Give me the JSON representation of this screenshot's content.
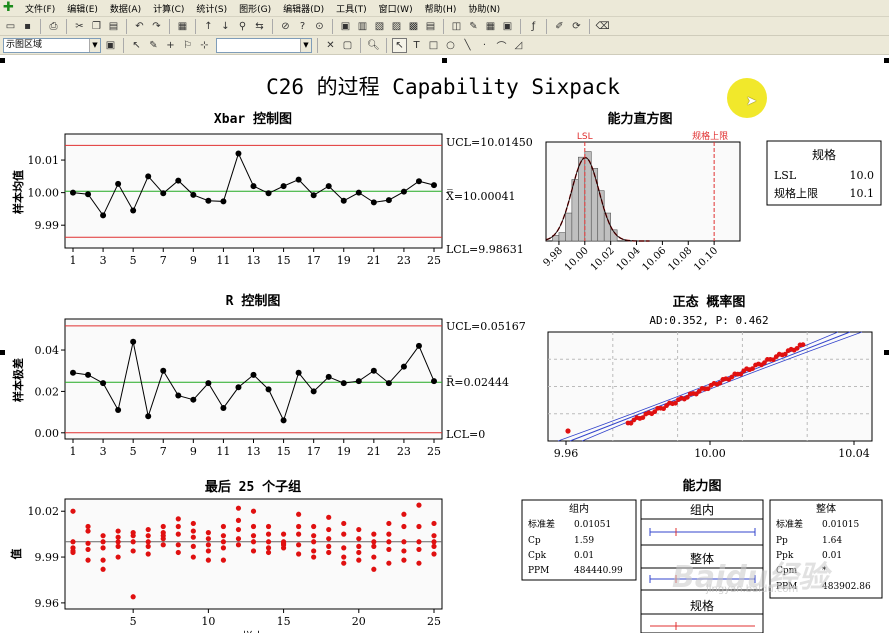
{
  "menu": [
    "文件(F)",
    "编辑(E)",
    "数据(A)",
    "计算(C)",
    "统计(S)",
    "图形(G)",
    "编辑器(D)",
    "工具(T)",
    "窗口(W)",
    "帮助(H)",
    "协助(N)"
  ],
  "toolbar": {
    "region_combo": "示图区域",
    "blank_combo": ""
  },
  "title": "C26 的过程 Capability Sixpack",
  "xbar": {
    "title": "Xbar 控制图",
    "ylabel": "样本均值",
    "ucl_label": "UCL=10.01450",
    "mean_label": "X̿=10.00041",
    "lcl_label": "LCL=9.98631",
    "ucl": 10.0145,
    "mean": 10.00041,
    "lcl": 9.98631,
    "yticks": [
      {
        "v": 9.99,
        "t": "9.99"
      },
      {
        "v": 10.0,
        "t": "10.00"
      },
      {
        "v": 10.01,
        "t": "10.01"
      }
    ],
    "ylim": [
      9.983,
      10.018
    ],
    "values": [
      10.0,
      9.9995,
      9.993,
      10.0027,
      9.9945,
      10.005,
      9.9998,
      10.0037,
      9.9993,
      9.9975,
      9.9973,
      10.012,
      10.002,
      9.9998,
      10.002,
      10.004,
      9.9992,
      10.002,
      9.9975,
      10.0,
      9.997,
      9.9977,
      10.0003,
      10.0035,
      10.0023
    ]
  },
  "rchart": {
    "title": "R 控制图",
    "ylabel": "样本极差",
    "ucl_label": "UCL=0.05167",
    "mean_label": "R̄=0.02444",
    "lcl_label": "LCL=0",
    "ucl": 0.05167,
    "mean": 0.02444,
    "lcl": 0,
    "yticks": [
      {
        "v": 0.0,
        "t": "0.00"
      },
      {
        "v": 0.02,
        "t": "0.02"
      },
      {
        "v": 0.04,
        "t": "0.04"
      }
    ],
    "ylim": [
      -0.003,
      0.055
    ],
    "values": [
      0.029,
      0.028,
      0.024,
      0.011,
      0.044,
      0.008,
      0.03,
      0.018,
      0.016,
      0.024,
      0.012,
      0.022,
      0.028,
      0.021,
      0.006,
      0.029,
      0.02,
      0.027,
      0.024,
      0.025,
      0.03,
      0.024,
      0.032,
      0.042,
      0.025
    ]
  },
  "xticks": [
    1,
    3,
    5,
    7,
    9,
    11,
    13,
    15,
    17,
    19,
    21,
    23,
    25
  ],
  "last25": {
    "title": "最后 25 个子组",
    "ylabel": "值",
    "xlabel": "样本",
    "center": 10.0,
    "ylim": [
      9.956,
      10.028
    ],
    "yticks": [
      {
        "v": 9.96,
        "t": "9.96"
      },
      {
        "v": 9.99,
        "t": "9.99"
      },
      {
        "v": 10.02,
        "t": "10.02"
      }
    ],
    "xticks": [
      5,
      10,
      15,
      20,
      25
    ],
    "points": [
      [
        1,
        10.02
      ],
      [
        1,
        10.0
      ],
      [
        1,
        9.996
      ],
      [
        1,
        9.994
      ],
      [
        1,
        9.993
      ],
      [
        2,
        10.01
      ],
      [
        2,
        10.007
      ],
      [
        2,
        9.999
      ],
      [
        2,
        9.995
      ],
      [
        2,
        9.988
      ],
      [
        3,
        10.004
      ],
      [
        3,
        10.0
      ],
      [
        3,
        9.996
      ],
      [
        3,
        9.988
      ],
      [
        3,
        9.982
      ],
      [
        4,
        10.007
      ],
      [
        4,
        10.003
      ],
      [
        4,
        10.0
      ],
      [
        4,
        9.997
      ],
      [
        4,
        9.99
      ],
      [
        5,
        10.006
      ],
      [
        5,
        10.004
      ],
      [
        5,
        10.0
      ],
      [
        5,
        9.994
      ],
      [
        5,
        9.964
      ],
      [
        6,
        10.008
      ],
      [
        6,
        10.004
      ],
      [
        6,
        10.0
      ],
      [
        6,
        9.997
      ],
      [
        6,
        9.992
      ],
      [
        7,
        10.01
      ],
      [
        7,
        10.006
      ],
      [
        7,
        10.004
      ],
      [
        7,
        10.002
      ],
      [
        7,
        9.998
      ],
      [
        8,
        10.015
      ],
      [
        8,
        10.01
      ],
      [
        8,
        10.005
      ],
      [
        8,
        9.998
      ],
      [
        8,
        9.993
      ],
      [
        9,
        10.012
      ],
      [
        9,
        10.007
      ],
      [
        9,
        10.003
      ],
      [
        9,
        9.997
      ],
      [
        9,
        9.99
      ],
      [
        10,
        10.006
      ],
      [
        10,
        10.002
      ],
      [
        10,
        9.998
      ],
      [
        10,
        9.994
      ],
      [
        10,
        9.988
      ],
      [
        11,
        10.01
      ],
      [
        11,
        10.004
      ],
      [
        11,
        10.0
      ],
      [
        11,
        9.996
      ],
      [
        11,
        9.988
      ],
      [
        12,
        10.022
      ],
      [
        12,
        10.014
      ],
      [
        12,
        10.008
      ],
      [
        12,
        10.002
      ],
      [
        12,
        9.998
      ],
      [
        13,
        10.02
      ],
      [
        13,
        10.01
      ],
      [
        13,
        10.004
      ],
      [
        13,
        10.0
      ],
      [
        13,
        9.994
      ],
      [
        14,
        10.01
      ],
      [
        14,
        10.005
      ],
      [
        14,
        10.0
      ],
      [
        14,
        9.996
      ],
      [
        14,
        9.993
      ],
      [
        15,
        10.005
      ],
      [
        15,
        10.0
      ],
      [
        15,
        9.998
      ],
      [
        15,
        9.996
      ],
      [
        15,
        9.999
      ],
      [
        16,
        10.018
      ],
      [
        16,
        10.01
      ],
      [
        16,
        10.005
      ],
      [
        16,
        9.998
      ],
      [
        16,
        9.992
      ],
      [
        17,
        10.01
      ],
      [
        17,
        10.004
      ],
      [
        17,
        10.0
      ],
      [
        17,
        9.994
      ],
      [
        17,
        9.99
      ],
      [
        18,
        10.016
      ],
      [
        18,
        10.008
      ],
      [
        18,
        10.002
      ],
      [
        18,
        9.997
      ],
      [
        18,
        9.993
      ],
      [
        19,
        10.012
      ],
      [
        19,
        10.005
      ],
      [
        19,
        9.996
      ],
      [
        19,
        9.99
      ],
      [
        19,
        9.986
      ],
      [
        20,
        10.008
      ],
      [
        20,
        10.002
      ],
      [
        20,
        9.997
      ],
      [
        20,
        9.993
      ],
      [
        20,
        9.988
      ],
      [
        21,
        10.005
      ],
      [
        21,
        10.0
      ],
      [
        21,
        9.997
      ],
      [
        21,
        9.99
      ],
      [
        21,
        9.982
      ],
      [
        22,
        10.012
      ],
      [
        22,
        10.005
      ],
      [
        22,
        10.0
      ],
      [
        22,
        9.995
      ],
      [
        22,
        9.986
      ],
      [
        23,
        10.018
      ],
      [
        23,
        10.01
      ],
      [
        23,
        10.0
      ],
      [
        23,
        9.994
      ],
      [
        23,
        9.988
      ],
      [
        24,
        10.024
      ],
      [
        24,
        10.01
      ],
      [
        24,
        10.0
      ],
      [
        24,
        9.995
      ],
      [
        24,
        9.986
      ],
      [
        25,
        10.012
      ],
      [
        25,
        10.004
      ],
      [
        25,
        10.0
      ],
      [
        25,
        9.997
      ],
      [
        25,
        9.992
      ]
    ]
  },
  "histogram": {
    "title": "能力直方图",
    "lsl_label": "LSL",
    "usl_label": "规格上限",
    "lsl": 10.0,
    "usl": 10.1,
    "xlim": [
      9.97,
      10.12
    ],
    "xticks": [
      9.98,
      10.0,
      10.02,
      10.04,
      10.06,
      10.08,
      10.1
    ],
    "xtick_labels": [
      "9.98",
      "10.00",
      "10.02",
      "10.04",
      "10.06",
      "10.08",
      "10.10"
    ],
    "bins": [
      {
        "x0": 9.975,
        "x1": 9.98,
        "h": 2
      },
      {
        "x0": 9.98,
        "x1": 9.985,
        "h": 3
      },
      {
        "x0": 9.985,
        "x1": 9.99,
        "h": 10
      },
      {
        "x0": 9.99,
        "x1": 9.995,
        "h": 22
      },
      {
        "x0": 9.995,
        "x1": 10.0,
        "h": 30
      },
      {
        "x0": 10.0,
        "x1": 10.005,
        "h": 32
      },
      {
        "x0": 10.005,
        "x1": 10.01,
        "h": 26
      },
      {
        "x0": 10.01,
        "x1": 10.015,
        "h": 18
      },
      {
        "x0": 10.015,
        "x1": 10.02,
        "h": 10
      },
      {
        "x0": 10.02,
        "x1": 10.025,
        "h": 4
      }
    ],
    "ymax": 34,
    "curve_mean": 10.0004,
    "curve_sd": 0.0105
  },
  "spec_box": {
    "title": "规格",
    "rows": [
      {
        "k": "LSL",
        "v": "10.0"
      },
      {
        "k": "规格上限",
        "v": "10.1"
      }
    ]
  },
  "probplot": {
    "title": "正态 概率图",
    "subtitle": "AD:0.352, P: 0.462",
    "xlim": [
      9.955,
      10.045
    ],
    "xticks": [
      9.96,
      10.0,
      10.04
    ],
    "xtick_labels": [
      "9.96",
      "10.00",
      "10.04"
    ]
  },
  "capplot": {
    "title": "能力图",
    "within_label": "组内",
    "overall_label": "整体",
    "spec_label": "规格"
  },
  "within_box": {
    "title": "组内",
    "rows": [
      {
        "k": "标准差",
        "v": "0.01051"
      },
      {
        "k": "Cp",
        "v": "1.59"
      },
      {
        "k": "Cpk",
        "v": "0.01"
      },
      {
        "k": "PPM",
        "v": "484440.99"
      }
    ]
  },
  "overall_box": {
    "title": "整体",
    "rows": [
      {
        "k": "标准差",
        "v": "0.01015"
      },
      {
        "k": "Pp",
        "v": "1.64"
      },
      {
        "k": "Ppk",
        "v": "0.01"
      },
      {
        "k": "Cpm",
        "v": "*"
      },
      {
        "k": "PPM",
        "v": "483902.86"
      }
    ]
  },
  "watermark": {
    "big": "Baidu经验",
    "small": "jingyan.baidu.com"
  },
  "colors": {
    "control": "#e03030",
    "center": "#22aa22",
    "point": "#000000",
    "dots": "#e01010",
    "bar": "#c0c0c0"
  }
}
